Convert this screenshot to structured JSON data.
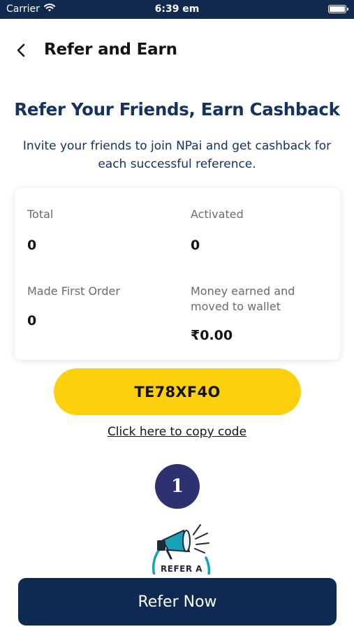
{
  "status_bar": {
    "carrier": "Carrier",
    "time": "6:39 em",
    "wifi_icon": "wifi-icon",
    "battery_icon": "battery-icon"
  },
  "header": {
    "title": "Refer and Earn",
    "back_icon": "chevron-left-icon"
  },
  "hero": {
    "headline": "Refer Your Friends, Earn Cashback",
    "subtitle": "Invite your friends to join NPai and get cashback for each successful reference."
  },
  "stats": {
    "total": {
      "label": "Total",
      "value": "0"
    },
    "activated": {
      "label": "Activated",
      "value": "0"
    },
    "first_order": {
      "label": "Made First Order",
      "value": "0"
    },
    "earned": {
      "label": "Money earned and moved to wallet",
      "value": "₹0.00"
    }
  },
  "referral": {
    "code": "TE78XF4O",
    "copy_label": "Click here to copy code"
  },
  "steps": {
    "current_step": "1",
    "illustration_icon": "megaphone-icon",
    "illustration_text": "REFER A"
  },
  "actions": {
    "refer_now": "Refer Now"
  },
  "colors": {
    "status_bar": "#122a50",
    "primary_navy": "#0e2a52",
    "headline_blue": "#153260",
    "accent_yellow": "#fdd00e",
    "step_badge": "#2b326f",
    "illustration_teal": "#16a2b8"
  }
}
